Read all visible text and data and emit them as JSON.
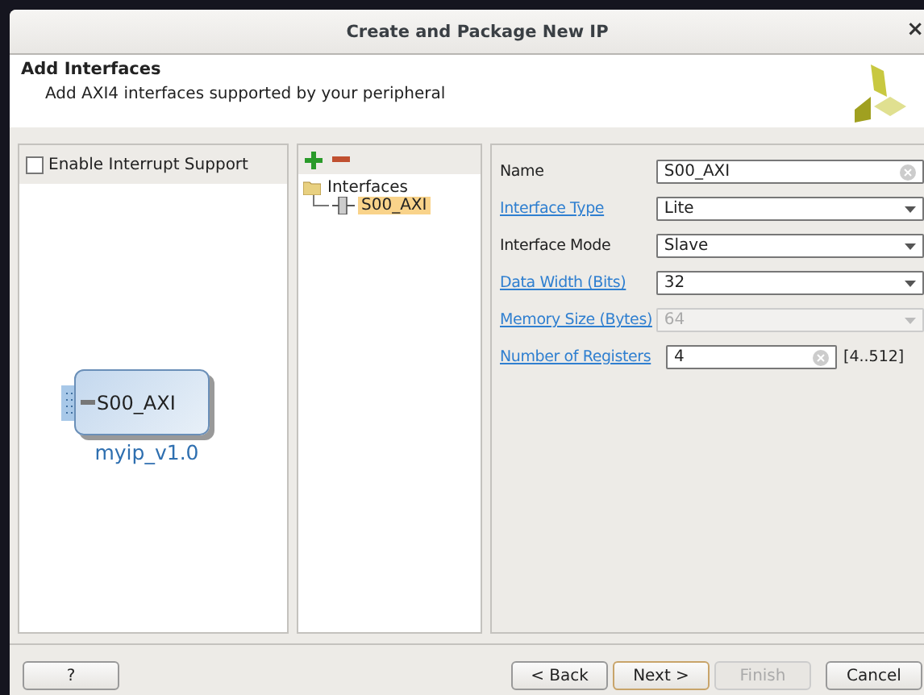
{
  "window": {
    "title": "Create and Package New IP",
    "close": "×"
  },
  "header": {
    "title": "Add Interfaces",
    "subtitle": "Add AXI4 interfaces supported by your peripheral"
  },
  "left_panel": {
    "checkbox": {
      "label": "Enable Interrupt Support",
      "checked": false
    },
    "block": {
      "port": "S00_AXI",
      "name": "myip_v1.0"
    }
  },
  "tree": {
    "root": "Interfaces",
    "children": [
      {
        "label": "S00_AXI",
        "selected": true
      }
    ]
  },
  "properties": [
    {
      "label": "Name",
      "link": false,
      "kind": "text",
      "value": "S00_AXI",
      "disabled": false
    },
    {
      "label": "Interface Type",
      "link": true,
      "kind": "combo",
      "value": "Lite",
      "disabled": false
    },
    {
      "label": "Interface Mode",
      "link": false,
      "kind": "combo",
      "value": "Slave",
      "disabled": false
    },
    {
      "label": "Data Width (Bits)",
      "link": true,
      "kind": "combo",
      "value": "32",
      "disabled": false
    },
    {
      "label": "Memory Size (Bytes)",
      "link": true,
      "kind": "combo",
      "value": "64",
      "disabled": true
    },
    {
      "label": "Number of Registers",
      "link": true,
      "kind": "text",
      "value": "4",
      "disabled": false,
      "range": "[4..512]"
    }
  ],
  "buttons": [
    {
      "label": "?",
      "kind": "help",
      "disabled": false,
      "default": false
    },
    {
      "label": "< Back",
      "kind": "nav",
      "disabled": false,
      "default": false
    },
    {
      "label": "Next >",
      "kind": "nav",
      "disabled": false,
      "default": true
    },
    {
      "label": "Finish",
      "kind": "nav",
      "disabled": true,
      "default": false
    },
    {
      "label": "Cancel",
      "kind": "cancel",
      "disabled": false,
      "default": false
    }
  ]
}
